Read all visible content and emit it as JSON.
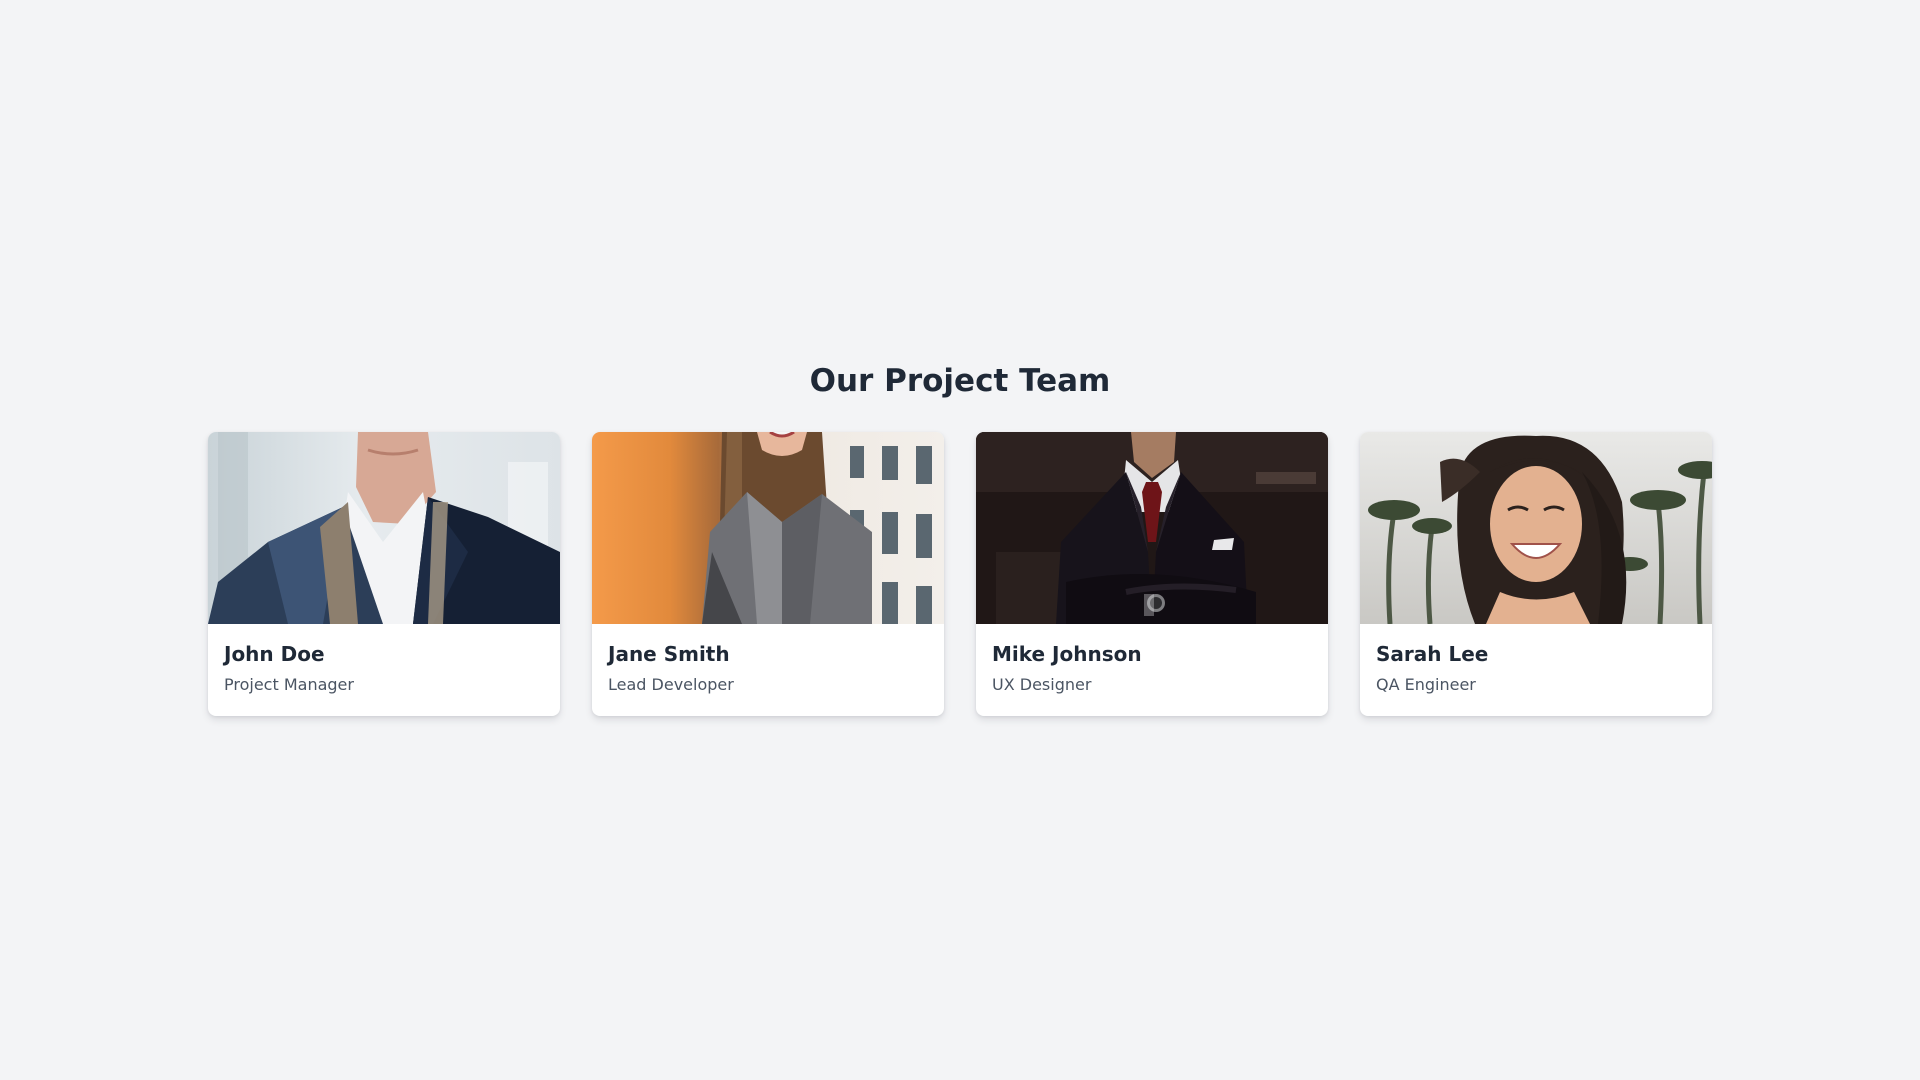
{
  "page": {
    "title": "Our Project Team",
    "background": "#f3f4f6"
  },
  "team": {
    "members": [
      {
        "name": "John Doe",
        "role": "Project Manager",
        "photo": "portrait-man-blazer"
      },
      {
        "name": "Jane Smith",
        "role": "Lead Developer",
        "photo": "portrait-woman-gray-jacket"
      },
      {
        "name": "Mike Johnson",
        "role": "UX Designer",
        "photo": "portrait-man-dark-suit"
      },
      {
        "name": "Sarah Lee",
        "role": "QA Engineer",
        "photo": "portrait-woman-smiling-palms"
      }
    ]
  },
  "colors": {
    "heading": "#1f2937",
    "role_text": "#4b5563",
    "card": "#ffffff"
  }
}
